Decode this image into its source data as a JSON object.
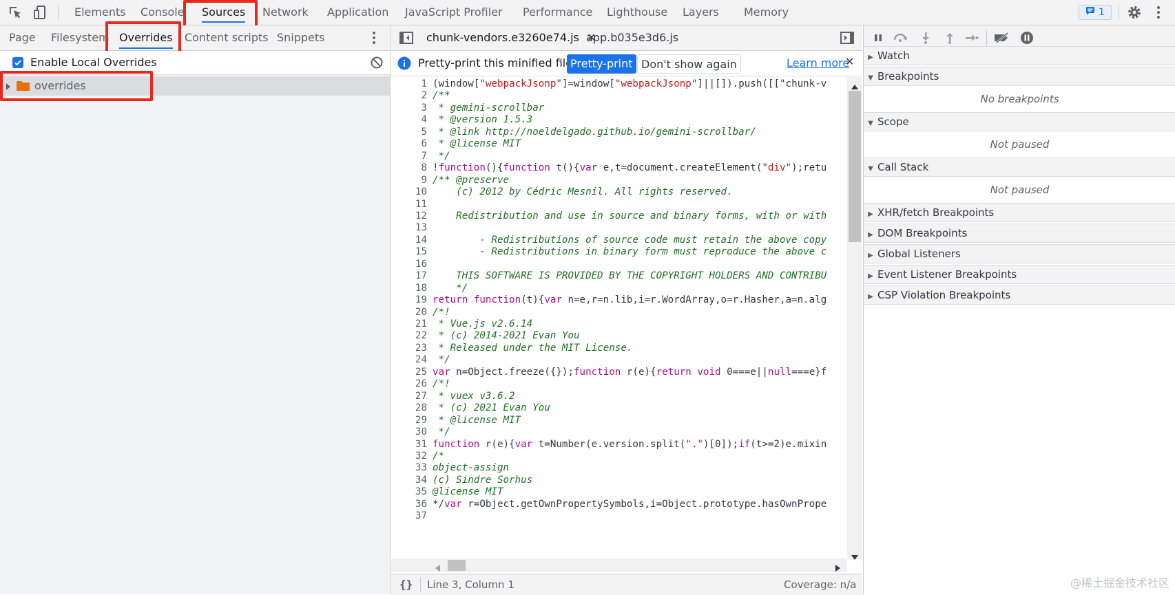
{
  "toolbar": {
    "tabs": [
      "Elements",
      "Console",
      "Sources",
      "Network",
      "Application",
      "JavaScript Profiler",
      "Performance",
      "Lighthouse",
      "Layers",
      "Memory"
    ],
    "active_tab": "Sources",
    "issues_count": "1"
  },
  "navigator": {
    "tabs": [
      "Page",
      "Filesystem",
      "Overrides",
      "Content scripts",
      "Snippets"
    ],
    "active_tab": "Overrides",
    "enable_overrides_label": "Enable Local Overrides",
    "enable_overrides_checked": true,
    "tree": [
      {
        "label": "overrides",
        "type": "folder"
      }
    ]
  },
  "editor": {
    "tabs": [
      {
        "label": "chunk-vendors.e3260e74.js",
        "closable": true,
        "active": true
      },
      {
        "label": "app.b035e3d6.js",
        "closable": false,
        "active": false
      }
    ],
    "infobar": {
      "message": "Pretty-print this minified file?",
      "primary_button": "Pretty-print",
      "secondary_button": "Don't show again",
      "link": "Learn more"
    },
    "code_lines": [
      {
        "n": "1",
        "t": "(window[\"webpackJsonp\"]=window[\"webpackJsonp\"]||[]).push([[\"chunk-v",
        "k": "code"
      },
      {
        "n": "2",
        "t": "/**",
        "k": "comment"
      },
      {
        "n": "3",
        "t": " * gemini-scrollbar",
        "k": "comment"
      },
      {
        "n": "4",
        "t": " * @version 1.5.3",
        "k": "comment"
      },
      {
        "n": "5",
        "t": " * @link http://noeldelgado.github.io/gemini-scrollbar/",
        "k": "comment"
      },
      {
        "n": "6",
        "t": " * @license MIT",
        "k": "comment"
      },
      {
        "n": "7",
        "t": " */",
        "k": "comment"
      },
      {
        "n": "8",
        "t": "!function(){function t(){var e,t=document.createElement(\"div\");retu",
        "k": "code"
      },
      {
        "n": "9",
        "t": "/** @preserve",
        "k": "comment"
      },
      {
        "n": "10",
        "t": "    (c) 2012 by Cédric Mesnil. All rights reserved.",
        "k": "comment"
      },
      {
        "n": "11",
        "t": "",
        "k": "comment"
      },
      {
        "n": "12",
        "t": "    Redistribution and use in source and binary forms, with or with",
        "k": "comment"
      },
      {
        "n": "13",
        "t": "",
        "k": "comment"
      },
      {
        "n": "14",
        "t": "        - Redistributions of source code must retain the above copy",
        "k": "comment"
      },
      {
        "n": "15",
        "t": "        - Redistributions in binary form must reproduce the above c",
        "k": "comment"
      },
      {
        "n": "16",
        "t": "",
        "k": "comment"
      },
      {
        "n": "17",
        "t": "    THIS SOFTWARE IS PROVIDED BY THE COPYRIGHT HOLDERS AND CONTRIBU",
        "k": "comment"
      },
      {
        "n": "18",
        "t": "    */",
        "k": "comment"
      },
      {
        "n": "19",
        "t": "return function(t){var n=e,r=n.lib,i=r.WordArray,o=r.Hasher,a=n.alg",
        "k": "code"
      },
      {
        "n": "20",
        "t": "/*!",
        "k": "comment"
      },
      {
        "n": "21",
        "t": " * Vue.js v2.6.14",
        "k": "comment"
      },
      {
        "n": "22",
        "t": " * (c) 2014-2021 Evan You",
        "k": "comment"
      },
      {
        "n": "23",
        "t": " * Released under the MIT License.",
        "k": "comment"
      },
      {
        "n": "24",
        "t": " */",
        "k": "comment"
      },
      {
        "n": "25",
        "t": "var n=Object.freeze({});function r(e){return void 0===e||null===e}f",
        "k": "code"
      },
      {
        "n": "26",
        "t": "/*!",
        "k": "comment"
      },
      {
        "n": "27",
        "t": " * vuex v3.6.2",
        "k": "comment"
      },
      {
        "n": "28",
        "t": " * (c) 2021 Evan You",
        "k": "comment"
      },
      {
        "n": "29",
        "t": " * @license MIT",
        "k": "comment"
      },
      {
        "n": "30",
        "t": " */",
        "k": "comment"
      },
      {
        "n": "31",
        "t": "function r(e){var t=Number(e.version.split(\".\")[0]);if(t>=2)e.mixin",
        "k": "code"
      },
      {
        "n": "32",
        "t": "/*",
        "k": "comment"
      },
      {
        "n": "33",
        "t": "object-assign",
        "k": "comment"
      },
      {
        "n": "34",
        "t": "(c) Sindre Sorhus",
        "k": "comment"
      },
      {
        "n": "35",
        "t": "@license MIT",
        "k": "comment"
      },
      {
        "n": "36",
        "t": "*/var r=Object.getOwnPropertySymbols,i=Object.prototype.hasOwnPrope",
        "k": "code"
      },
      {
        "n": "37",
        "t": "",
        "k": "code"
      }
    ],
    "status": {
      "position": "Line 3, Column 1",
      "coverage": "Coverage: n/a"
    }
  },
  "debugger": {
    "sections": [
      {
        "label": "Watch",
        "expanded": false
      },
      {
        "label": "Breakpoints",
        "expanded": true,
        "body": "No breakpoints"
      },
      {
        "label": "Scope",
        "expanded": true,
        "body": "Not paused"
      },
      {
        "label": "Call Stack",
        "expanded": true,
        "body": "Not paused"
      },
      {
        "label": "XHR/fetch Breakpoints",
        "expanded": false
      },
      {
        "label": "DOM Breakpoints",
        "expanded": false
      },
      {
        "label": "Global Listeners",
        "expanded": false
      },
      {
        "label": "Event Listener Breakpoints",
        "expanded": false
      },
      {
        "label": "CSP Violation Breakpoints",
        "expanded": false
      }
    ]
  },
  "watermark": "@稀土掘金技术社区",
  "colors": {
    "accent": "#1a73e8",
    "highlight": "#e8281c",
    "folder": "#e8710a"
  }
}
